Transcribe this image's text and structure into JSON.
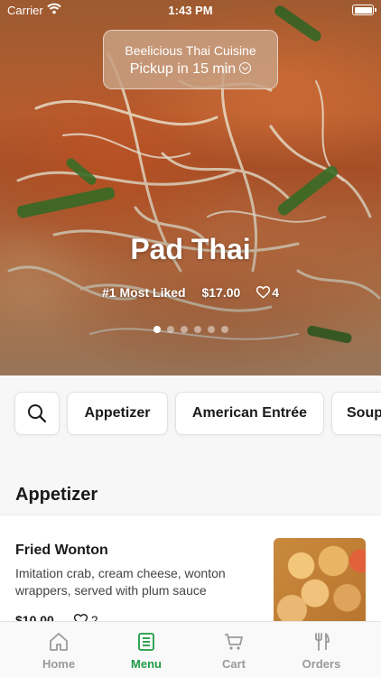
{
  "status_bar": {
    "carrier": "Carrier",
    "time": "1:43 PM"
  },
  "pickup": {
    "restaurant": "Beelicious Thai Cuisine",
    "time_text": "Pickup in 15 min"
  },
  "featured": {
    "name": "Pad Thai",
    "rank": "#1 Most Liked",
    "price": "$17.00",
    "likes": "4",
    "page_count": 6,
    "active_page": 0
  },
  "categories": {
    "items": [
      "Appetizer",
      "American Entrée",
      "Soup"
    ]
  },
  "section": {
    "title": "Appetizer"
  },
  "menu_item": {
    "name": "Fried Wonton",
    "description": "Imitation crab, cream cheese, wonton wrappers, served with plum sauce",
    "price": "$10.00",
    "likes": "2"
  },
  "tabs": [
    {
      "label": "Home",
      "icon": "home-icon"
    },
    {
      "label": "Menu",
      "icon": "menu-icon"
    },
    {
      "label": "Cart",
      "icon": "cart-icon"
    },
    {
      "label": "Orders",
      "icon": "orders-icon"
    }
  ],
  "colors": {
    "accent": "#1e9b44",
    "inactive_tab": "#9a9a9a"
  }
}
